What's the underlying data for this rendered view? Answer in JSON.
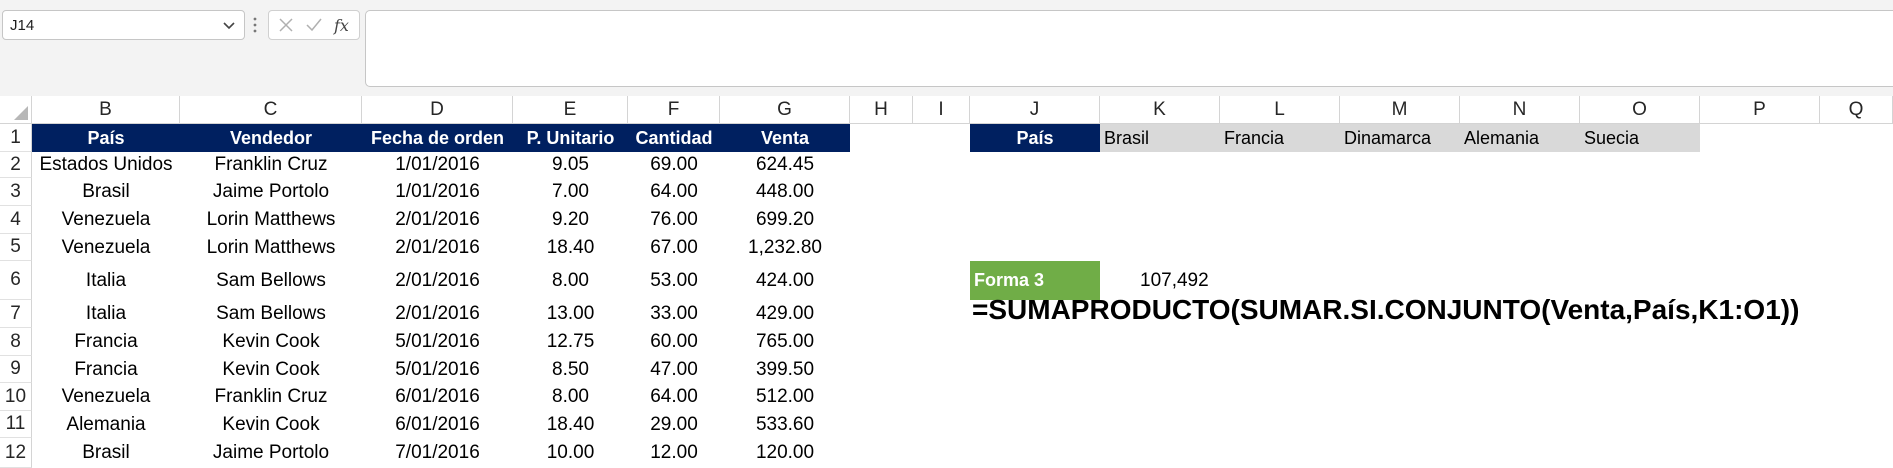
{
  "formula_bar": {
    "name_box": "J14",
    "formula_content": ""
  },
  "icons": {
    "namebox_dropdown": "chevron-down-icon",
    "more": "vertical-ellipsis-icon",
    "cancel": "x-icon",
    "enter": "checkmark-icon",
    "insert_function": "fx-icon"
  },
  "columns": [
    "B",
    "C",
    "D",
    "E",
    "F",
    "G",
    "H",
    "I",
    "J",
    "K",
    "L",
    "M",
    "N",
    "O",
    "P",
    "Q"
  ],
  "rows": [
    "1",
    "2",
    "3",
    "4",
    "5",
    "6",
    "7",
    "8",
    "9",
    "10",
    "11",
    "12"
  ],
  "table": {
    "headers": [
      "País",
      "Vendedor",
      "Fecha de orden",
      "P. Unitario",
      "Cantidad",
      "Venta"
    ],
    "data": [
      [
        "Estados Unidos",
        "Franklin Cruz",
        "1/01/2016",
        "9.05",
        "69.00",
        "624.45"
      ],
      [
        "Brasil",
        "Jaime Portolo",
        "1/01/2016",
        "7.00",
        "64.00",
        "448.00"
      ],
      [
        "Venezuela",
        "Lorin Matthews",
        "2/01/2016",
        "9.20",
        "76.00",
        "699.20"
      ],
      [
        "Venezuela",
        "Lorin Matthews",
        "2/01/2016",
        "18.40",
        "67.00",
        "1,232.80"
      ],
      [
        "Italia",
        "Sam Bellows",
        "2/01/2016",
        "8.00",
        "53.00",
        "424.00"
      ],
      [
        "Italia",
        "Sam Bellows",
        "2/01/2016",
        "13.00",
        "33.00",
        "429.00"
      ],
      [
        "Francia",
        "Kevin Cook",
        "5/01/2016",
        "12.75",
        "60.00",
        "765.00"
      ],
      [
        "Francia",
        "Kevin Cook",
        "5/01/2016",
        "8.50",
        "47.00",
        "399.50"
      ],
      [
        "Venezuela",
        "Franklin Cruz",
        "6/01/2016",
        "8.00",
        "64.00",
        "512.00"
      ],
      [
        "Alemania",
        "Kevin Cook",
        "6/01/2016",
        "18.40",
        "29.00",
        "533.60"
      ],
      [
        "Brasil",
        "Jaime Portolo",
        "7/01/2016",
        "10.00",
        "12.00",
        "120.00"
      ]
    ]
  },
  "criteria": {
    "label": "País",
    "countries": [
      "Brasil",
      "Francia",
      "Dinamarca",
      "Alemania",
      "Suecia"
    ]
  },
  "result": {
    "label": "Forma 3",
    "value": "107,492",
    "formula": "=SUMAPRODUCTO(SUMAR.SI.CONJUNTO(Venta,País,K1:O1))"
  },
  "colors": {
    "header_bg": "#002060",
    "criteria_bg": "#d9d9d9",
    "forma_bg": "#70ad47"
  }
}
